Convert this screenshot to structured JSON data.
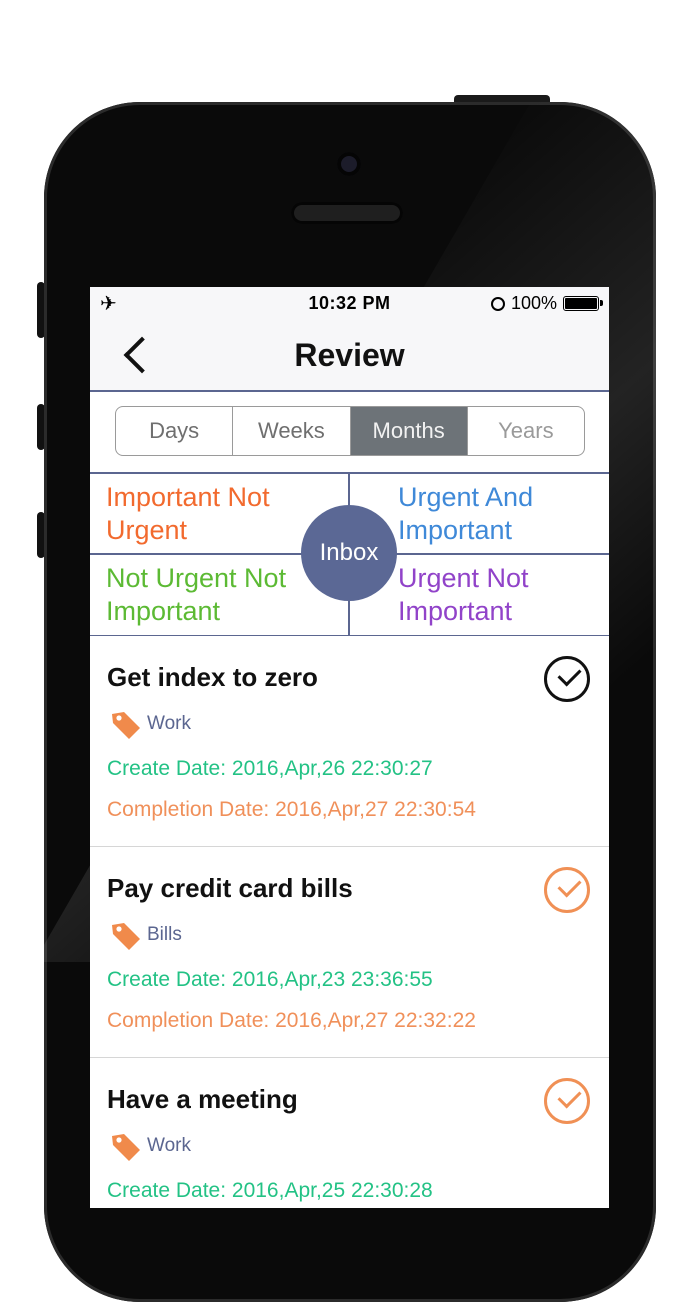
{
  "status": {
    "time": "10:32 PM",
    "battery": "100%"
  },
  "nav": {
    "title": "Review"
  },
  "segments": [
    "Days",
    "Weeks",
    "Months",
    "Years"
  ],
  "segments_active_index": 2,
  "quadrants": {
    "important_not_urgent": "Important Not Urgent",
    "urgent_and_important": "Urgent And Important",
    "not_urgent_not_important": "Not Urgent Not Important",
    "urgent_not_important": "Urgent Not Important",
    "inbox": "Inbox"
  },
  "tasks": [
    {
      "title": "Get index to zero",
      "tag": "Work",
      "create": "Create Date: 2016,Apr,26 22:30:27",
      "completion": "Completion Date: 2016,Apr,27 22:30:54"
    },
    {
      "title": "Pay credit card bills",
      "tag": "Bills",
      "create": "Create Date: 2016,Apr,23 23:36:55",
      "completion": "Completion Date: 2016,Apr,27 22:32:22"
    },
    {
      "title": "Have a meeting",
      "tag": "Work",
      "create": "Create Date: 2016,Apr,25 22:30:28",
      "completion": ""
    }
  ],
  "colors": {
    "accent": "#5b6690",
    "important_not_urgent": "#f26a2e",
    "urgent_and_important": "#3f89d8",
    "not_urgent_not_important": "#5cba34",
    "urgent_not_important": "#9143c9",
    "create_date": "#23c285",
    "completion_date": "#f0905a"
  }
}
